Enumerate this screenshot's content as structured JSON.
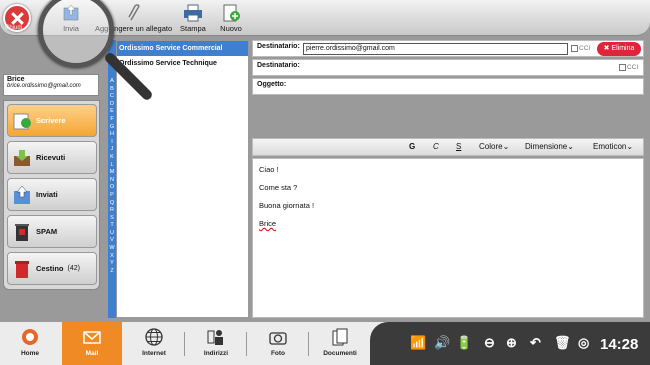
{
  "toolbar": {
    "close_label": "Chiudi",
    "send_label": "Invia",
    "attach_label": "Aggiungere un allegato",
    "print_label": "Stampa",
    "new_label": "Nuovo"
  },
  "user": {
    "name": "Brice",
    "email": "brice.ordissimo@gmail.com"
  },
  "folders": [
    {
      "label": "Scrivere",
      "icon": "pencil-icon",
      "active": true
    },
    {
      "label": "Ricevuti",
      "icon": "inbox-icon"
    },
    {
      "label": "Inviati",
      "icon": "sent-icon"
    },
    {
      "label": "SPAM",
      "icon": "spam-trash-icon"
    },
    {
      "label": "Cestino",
      "icon": "trash-icon",
      "count": "(42)"
    }
  ],
  "alphabet": "A B C D E F G H I J K L M N O P Q R S T U V W X Y Z",
  "contacts": [
    {
      "name": "Ordissimo Service Commercial",
      "selected": true
    },
    {
      "name": "Ordissimo Service Technique",
      "selected": false
    }
  ],
  "compose": {
    "to_label": "Destinatario:",
    "to_value": "pierre.ordissimo@gmail.com",
    "cc_label": "CCI",
    "delete_label": "Elimina",
    "to2_label": "Destinatario:",
    "cc2_label": "CCI",
    "subject_label": "Oggetto:",
    "subject_value": "",
    "format": {
      "bold": "G",
      "italic": "C",
      "underline": "S",
      "color": "Colore",
      "size": "Dimensione",
      "emoticon": "Emoticon"
    },
    "body_lines": [
      "Ciao !",
      "Come sta ?",
      "Buona giornata !",
      "Brice"
    ]
  },
  "taskbar": {
    "items": [
      "Home",
      "Mail",
      "Internet",
      "Indirizzi",
      "Foto",
      "Documenti"
    ],
    "active": "Mail",
    "time": "14:28"
  },
  "colors": {
    "accent_orange": "#f08a24",
    "selection_blue": "#3f7fd0",
    "delete_red": "#e0243a"
  }
}
